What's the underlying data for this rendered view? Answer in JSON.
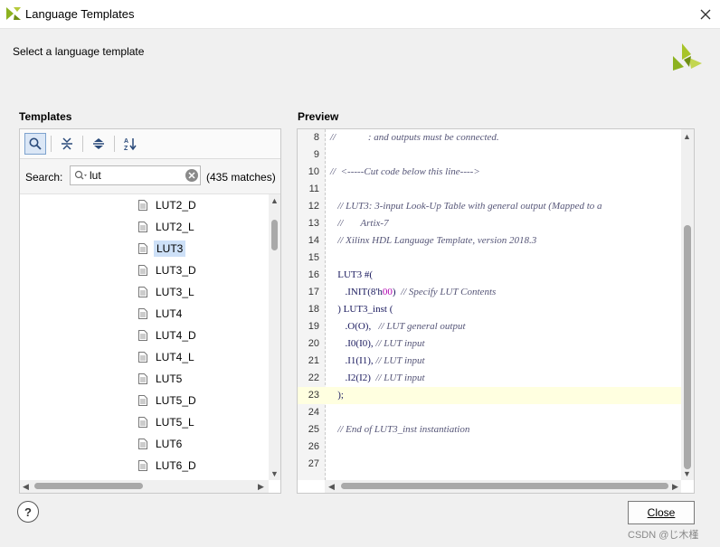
{
  "window": {
    "title": "Language Templates"
  },
  "header": {
    "subtitle": "Select a language template"
  },
  "templates": {
    "section_label": "Templates",
    "search_label": "Search:",
    "search_value": "lut",
    "match_count": "(435 matches)",
    "items": [
      "LUT2_D",
      "LUT2_L",
      "LUT3",
      "LUT3_D",
      "LUT3_L",
      "LUT4",
      "LUT4_D",
      "LUT4_L",
      "LUT5",
      "LUT5_D",
      "LUT5_L",
      "LUT6",
      "LUT6_D"
    ],
    "selected": "LUT3"
  },
  "preview": {
    "section_label": "Preview",
    "lines": [
      {
        "n": "8",
        "text": "//             : and outputs must be connected."
      },
      {
        "n": "9",
        "text": ""
      },
      {
        "n": "10",
        "text": "//  <-----Cut code below this line---->"
      },
      {
        "n": "11",
        "text": ""
      },
      {
        "n": "12",
        "text": "   // LUT3: 3-input Look-Up Table with general output (Mapped to a"
      },
      {
        "n": "13",
        "text": "   //       Artix-7"
      },
      {
        "n": "14",
        "text": "   // Xilinx HDL Language Template, version 2018.3"
      },
      {
        "n": "15",
        "text": ""
      },
      {
        "n": "16",
        "text": "   LUT3 #("
      },
      {
        "n": "17",
        "text": "      .INIT(8'h00)  // Specify LUT Contents"
      },
      {
        "n": "18",
        "text": "   ) LUT3_inst ("
      },
      {
        "n": "19",
        "text": "      .O(O),   // LUT general output"
      },
      {
        "n": "20",
        "text": "      .I0(I0), // LUT input"
      },
      {
        "n": "21",
        "text": "      .I1(I1), // LUT input"
      },
      {
        "n": "22",
        "text": "      .I2(I2)  // LUT input"
      },
      {
        "n": "23",
        "text": "   );"
      },
      {
        "n": "24",
        "text": ""
      },
      {
        "n": "25",
        "text": "   // End of LUT3_inst instantiation"
      },
      {
        "n": "26",
        "text": ""
      },
      {
        "n": "27",
        "text": ""
      }
    ],
    "highlighted_line": "23"
  },
  "footer": {
    "help_label": "?",
    "close_label": "Close",
    "watermark": "CSDN @じ木槿"
  },
  "colors": {
    "selection": "#cde0f7",
    "current_line": "#ffffe0",
    "logo": "#9fbf1f"
  }
}
